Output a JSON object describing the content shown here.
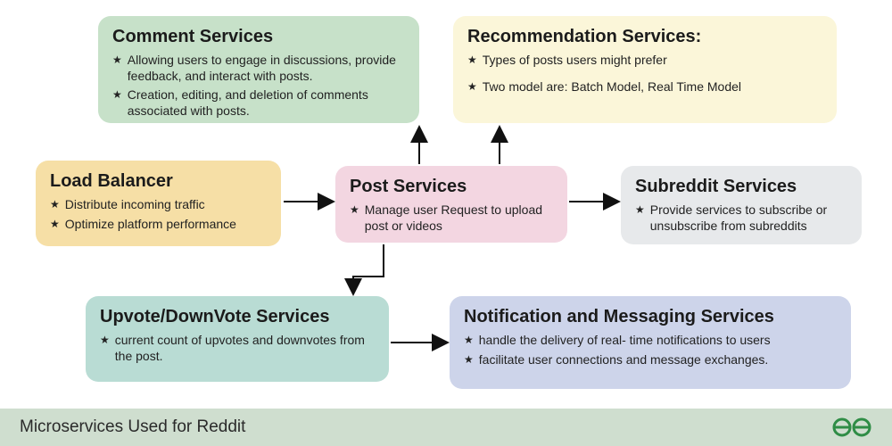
{
  "footer": {
    "title": "Microservices Used for Reddit"
  },
  "boxes": {
    "comment": {
      "title": "Comment Services",
      "bullets": [
        "Allowing users to engage in discussions, provide feedback, and interact with posts.",
        "Creation, editing, and deletion of comments associated with posts."
      ]
    },
    "recommendation": {
      "title": "Recommendation Services:",
      "bullets": [
        "Types of posts users might prefer",
        "Two model are: Batch Model, Real Time Model"
      ]
    },
    "load_balancer": {
      "title": "Load Balancer",
      "bullets": [
        "Distribute incoming traffic",
        "Optimize platform performance"
      ]
    },
    "post": {
      "title": "Post Services",
      "bullets": [
        "Manage user Request to upload post or videos"
      ]
    },
    "subreddit": {
      "title": "Subreddit Services",
      "bullets": [
        "Provide services to subscribe or unsubscribe from subreddits"
      ]
    },
    "upvote": {
      "title": "Upvote/DownVote Services",
      "bullets": [
        "current count of upvotes and downvotes from the post."
      ]
    },
    "notification": {
      "title": "Notification and Messaging Services",
      "bullets": [
        "handle the delivery of real- time notifications to users",
        "facilitate user connections and message exchanges."
      ]
    }
  }
}
